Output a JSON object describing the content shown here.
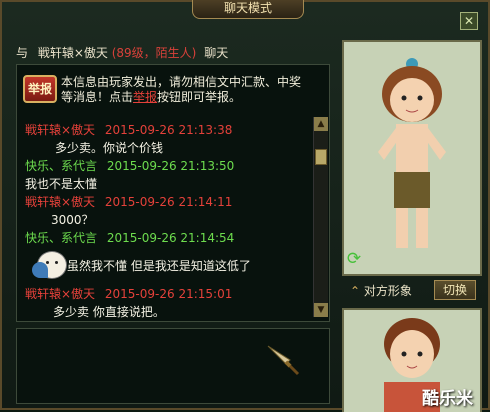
{
  "window": {
    "title": "聊天模式",
    "close_icon": "close-x-icon"
  },
  "header": {
    "prefix": "与",
    "name": "戦轩辕×傲天",
    "info": "(89级，陌生人)",
    "suffix": "聊天"
  },
  "notice": {
    "button_label": "举报",
    "text_before": "本信息由玩家发出，请勿相信文中汇款、中奖等消息！点击",
    "link": "举报",
    "text_after": "按钮即可举报。"
  },
  "messages": [
    {
      "sender": "戦轩辕×傲天",
      "time": "2015-09-26 21:13:38",
      "text": "多少卖。你说个价钱",
      "color": "red"
    },
    {
      "sender": "快乐、系代言",
      "time": "2015-09-26 21:13:50",
      "text": "我也不是太懂",
      "color": "green"
    },
    {
      "sender": "戦轩辕×傲天",
      "time": "2015-09-26 21:14:11",
      "text": "3000？",
      "color": "red"
    },
    {
      "sender": "快乐、系代言",
      "time": "2015-09-26 21:14:54",
      "text": "虽然我不懂 但是我还是知道这低了",
      "color": "green"
    },
    {
      "sender": "戦轩辕×傲天",
      "time": "2015-09-26 21:15:01",
      "text": "多少卖 你直接说把。",
      "color": "red"
    }
  ],
  "right_panel": {
    "target_label": "对方形象",
    "switch_label": "切换"
  },
  "watermark": "酷乐米",
  "colors": {
    "red_name": "#e4413a",
    "green_name": "#6ddc4e",
    "frame": "#5a4a2a"
  }
}
